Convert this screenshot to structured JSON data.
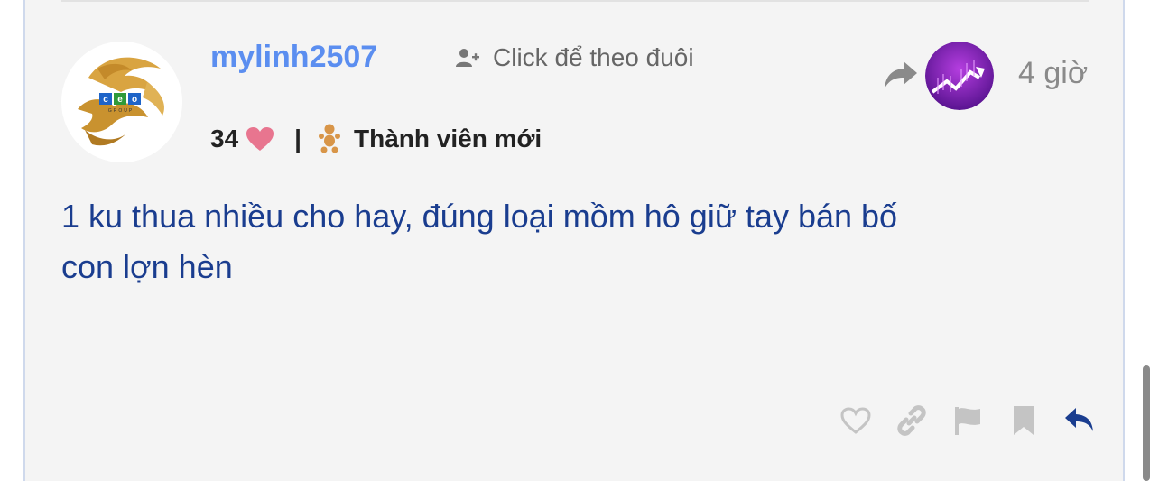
{
  "post": {
    "username": "mylinh2507",
    "follow_label": "Click để theo đuôi",
    "likes_count": "34",
    "separator": "|",
    "rank_label": "Thành viên mới",
    "time_ago": "4 giờ",
    "content_line1": "1 ku thua nhiều cho hay, đúng loại mồm hô giữ tay bán bố",
    "content_line2": "con lợn hèn",
    "avatar_logo_text": "ceo",
    "avatar_logo_subtext": "GROUP"
  },
  "icons": {
    "follow": "user-plus-icon",
    "likes": "heart-icon",
    "rank": "baby-icon",
    "share": "share-arrow-icon",
    "actions": [
      "heart-outline-icon",
      "link-icon",
      "flag-icon",
      "bookmark-icon",
      "reply-icon"
    ]
  },
  "colors": {
    "username": "#5b8ef0",
    "content": "#1a3d8f",
    "heart": "#e8758f",
    "reply": "#1a3d8f",
    "action_gray": "#c4c4c4"
  }
}
